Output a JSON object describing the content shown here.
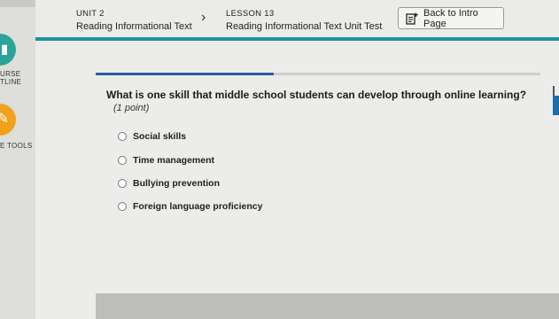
{
  "sidebar": {
    "course_label_1": "URSE",
    "course_label_2": "TLINE",
    "tools_label": "E TOOLS"
  },
  "header": {
    "unit_label": "UNIT 2",
    "unit_title": "Reading Informational Text",
    "lesson_label": "LESSON 13",
    "lesson_title": "Reading Informational Text Unit Test",
    "back_button_label": "Back to Intro Page"
  },
  "progress": {
    "fraction": 0.4
  },
  "question": {
    "text": "What is one skill that middle school students can develop through online learning?",
    "points": "(1 point)",
    "options": [
      "Social skills",
      "Time management",
      "Bullying prevention",
      "Foreign language proficiency"
    ]
  },
  "colors": {
    "accent_teal": "#1e93a0",
    "progress_blue": "#2c5f9e",
    "tool_orange": "#f0a21c"
  }
}
